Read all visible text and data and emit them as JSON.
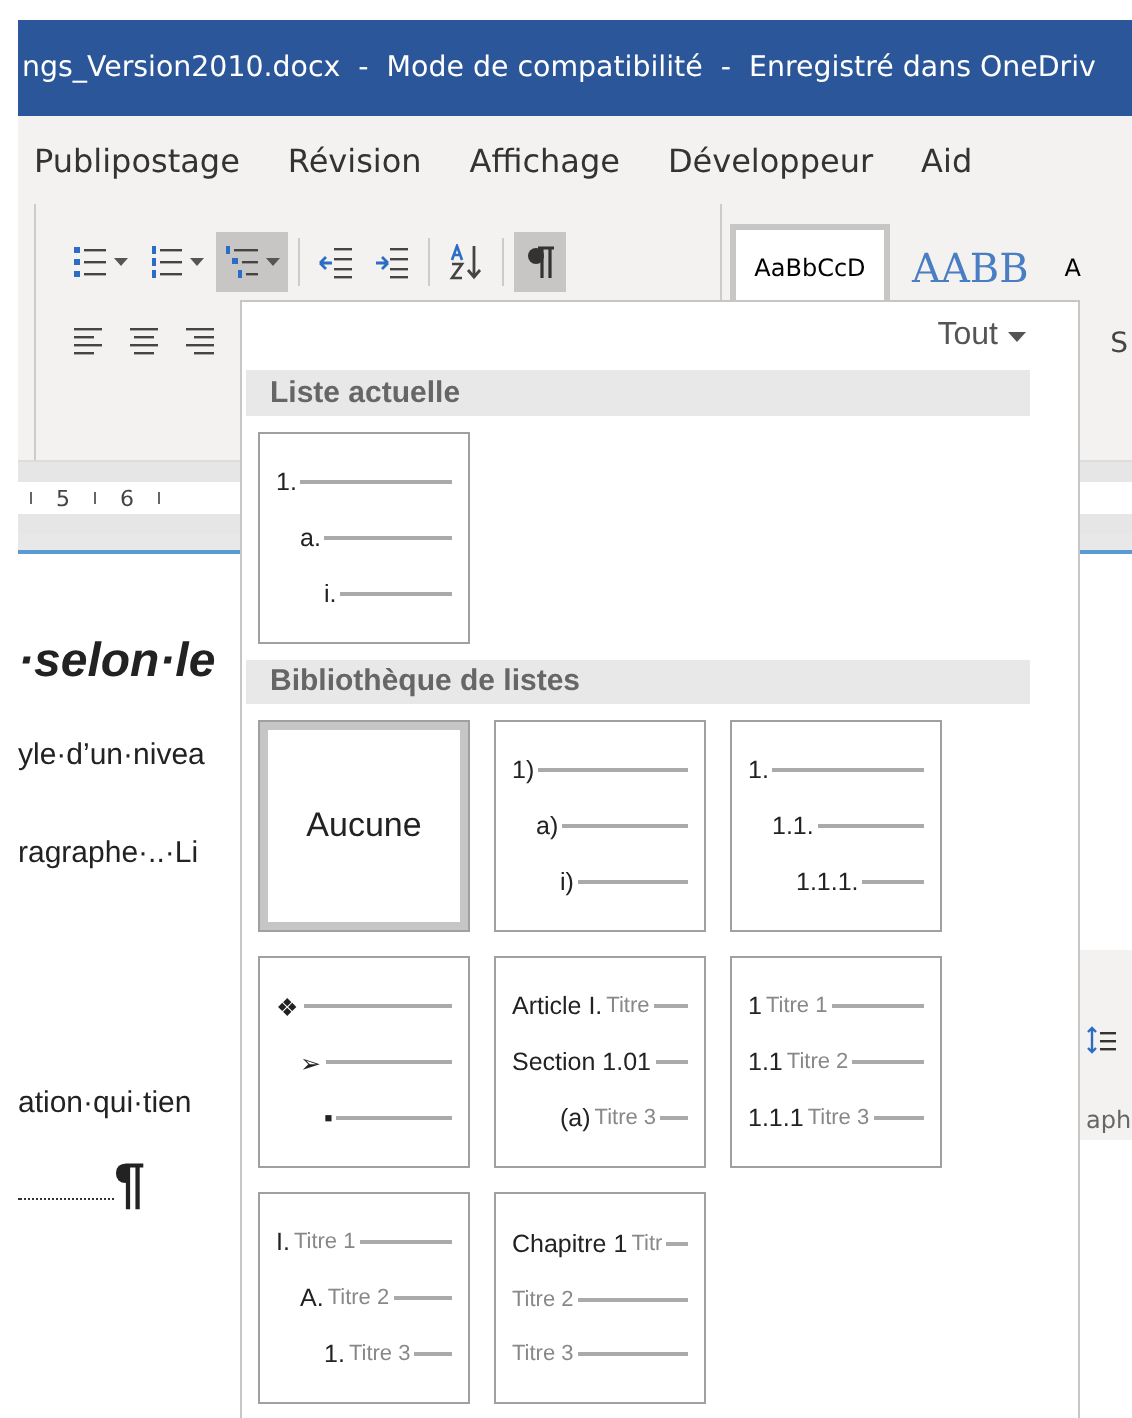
{
  "window": {
    "title": "ngs_Version2010.docx  -  Mode de compatibilité  -  Enregistré dans OneDriv"
  },
  "tabs": [
    {
      "label": "Publipostage",
      "selected": false
    },
    {
      "label": "Révision",
      "selected": false
    },
    {
      "label": "Affichage",
      "selected": false
    },
    {
      "label": "Développeur",
      "selected": false
    },
    {
      "label": "Aid",
      "selected": false
    }
  ],
  "ribbon": {
    "row_1": [
      {
        "kind": "bullets",
        "selected": false,
        "caret": true
      },
      {
        "kind": "numbering",
        "selected": false,
        "caret": true
      },
      {
        "kind": "multilevel",
        "selected": true,
        "caret": true
      },
      {
        "kind": "outdent",
        "selected": false,
        "caret": false
      },
      {
        "kind": "indent",
        "selected": false,
        "caret": false
      },
      {
        "kind": "sort",
        "selected": false,
        "caret": false
      },
      {
        "kind": "pilcrow",
        "selected": true,
        "caret": false
      }
    ],
    "row_2": [
      {
        "kind": "align-left",
        "selected": false
      },
      {
        "kind": "align-center",
        "selected": false
      },
      {
        "kind": "align-right",
        "selected": false
      }
    ],
    "styles": [
      {
        "sample": "AaBbCcD",
        "kind": "normal",
        "selected": true
      },
      {
        "sample": "AABB",
        "kind": "title",
        "selected": false
      },
      {
        "sample": "A",
        "kind": "small",
        "selected": false
      }
    ],
    "side_label": "S"
  },
  "ruler": {
    "labels": [
      "5",
      "6"
    ]
  },
  "document": {
    "lines": [
      {
        "text": "·selon·le",
        "kind": "heading"
      },
      {
        "text": "yle·d’un·nivea",
        "kind": "body"
      },
      {
        "text": "ragraphe·..·Li",
        "kind": "body"
      },
      {
        "text": "ation·qui·tien",
        "kind": "body"
      },
      {
        "text": "¶",
        "kind": "leader"
      }
    ]
  },
  "side_pane": {
    "label": "aph"
  },
  "dropdown": {
    "filter": "Tout",
    "sections": [
      {
        "title": "Liste actuelle",
        "items": [
          {
            "kind": "levels",
            "selected": false,
            "lines": [
              {
                "number": "1."
              },
              {
                "number": "a."
              },
              {
                "number": "i."
              }
            ]
          }
        ]
      },
      {
        "title": "Bibliothèque de listes",
        "items": [
          {
            "kind": "none",
            "label": "Aucune",
            "selected": true
          },
          {
            "kind": "levels",
            "selected": false,
            "lines": [
              {
                "number": "1)"
              },
              {
                "number": "a)"
              },
              {
                "number": "i)"
              }
            ]
          },
          {
            "kind": "levels",
            "selected": false,
            "lines": [
              {
                "number": "1."
              },
              {
                "number": "1.1."
              },
              {
                "number": "1.1.1."
              }
            ]
          },
          {
            "kind": "levels",
            "selected": false,
            "lines": [
              {
                "number": "❖"
              },
              {
                "number": "➢"
              },
              {
                "number": "▪"
              }
            ]
          },
          {
            "kind": "levels",
            "selected": false,
            "lines": [
              {
                "number": "Article I.",
                "caption": "Titre"
              },
              {
                "number": "Section 1.01",
                "flush": true
              },
              {
                "number": "(a)",
                "caption": "Titre 3"
              }
            ]
          },
          {
            "kind": "levels",
            "selected": false,
            "lines": [
              {
                "number": "1",
                "caption": "Titre 1"
              },
              {
                "number": "1.1",
                "caption": "Titre 2",
                "flush": true
              },
              {
                "number": "1.1.1",
                "caption": "Titre 3",
                "flush": true
              }
            ]
          },
          {
            "kind": "levels",
            "selected": false,
            "lines": [
              {
                "number": "I.",
                "caption": "Titre 1"
              },
              {
                "number": "A.",
                "caption": "Titre 2"
              },
              {
                "number": "1.",
                "caption": "Titre 3"
              }
            ]
          },
          {
            "kind": "levels",
            "selected": false,
            "lines": [
              {
                "number": "Chapitre 1",
                "caption": "Titr"
              },
              {
                "caption": "Titre 2",
                "flush": true
              },
              {
                "caption": "Titre 3",
                "flush": true
              }
            ]
          }
        ]
      }
    ]
  }
}
